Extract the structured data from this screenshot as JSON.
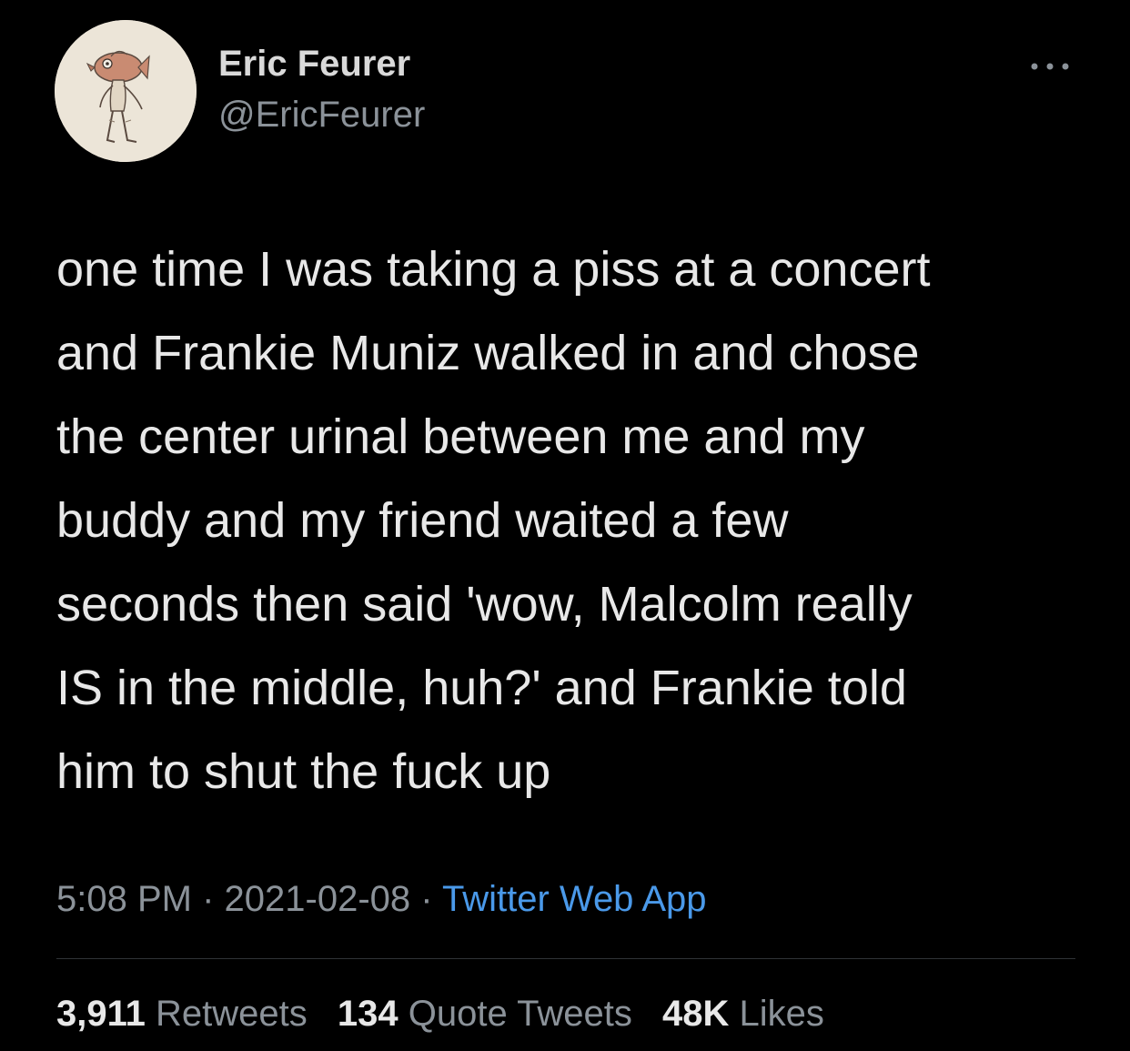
{
  "user": {
    "name": "Eric Feurer",
    "handle": "@EricFeurer",
    "avatar": "fish-headed-figure-sketch"
  },
  "more_icon": "more-horizontal-icon",
  "tweet": {
    "lines": [
      "one time I was taking a piss at a concert",
      "and Frankie Muniz walked in and chose",
      "the center urinal between me and my",
      "buddy and my friend waited a few",
      "seconds then said 'wow, Malcolm really",
      "IS in the middle, huh?' and Frankie told",
      "him to shut the fuck up"
    ]
  },
  "meta": {
    "time": "5:08 PM",
    "separator": "·",
    "date": "2021-02-08",
    "source": "Twitter Web App"
  },
  "stats": {
    "retweets": {
      "count": "3,911",
      "label": "Retweets"
    },
    "quote_tweets": {
      "count": "134",
      "label": "Quote Tweets"
    },
    "likes": {
      "count": "48K",
      "label": "Likes"
    }
  },
  "colors": {
    "background": "#000000",
    "text": "#e8e8e8",
    "secondary": "#8b9299",
    "link": "#4a99e9",
    "divider": "#2f3336"
  }
}
